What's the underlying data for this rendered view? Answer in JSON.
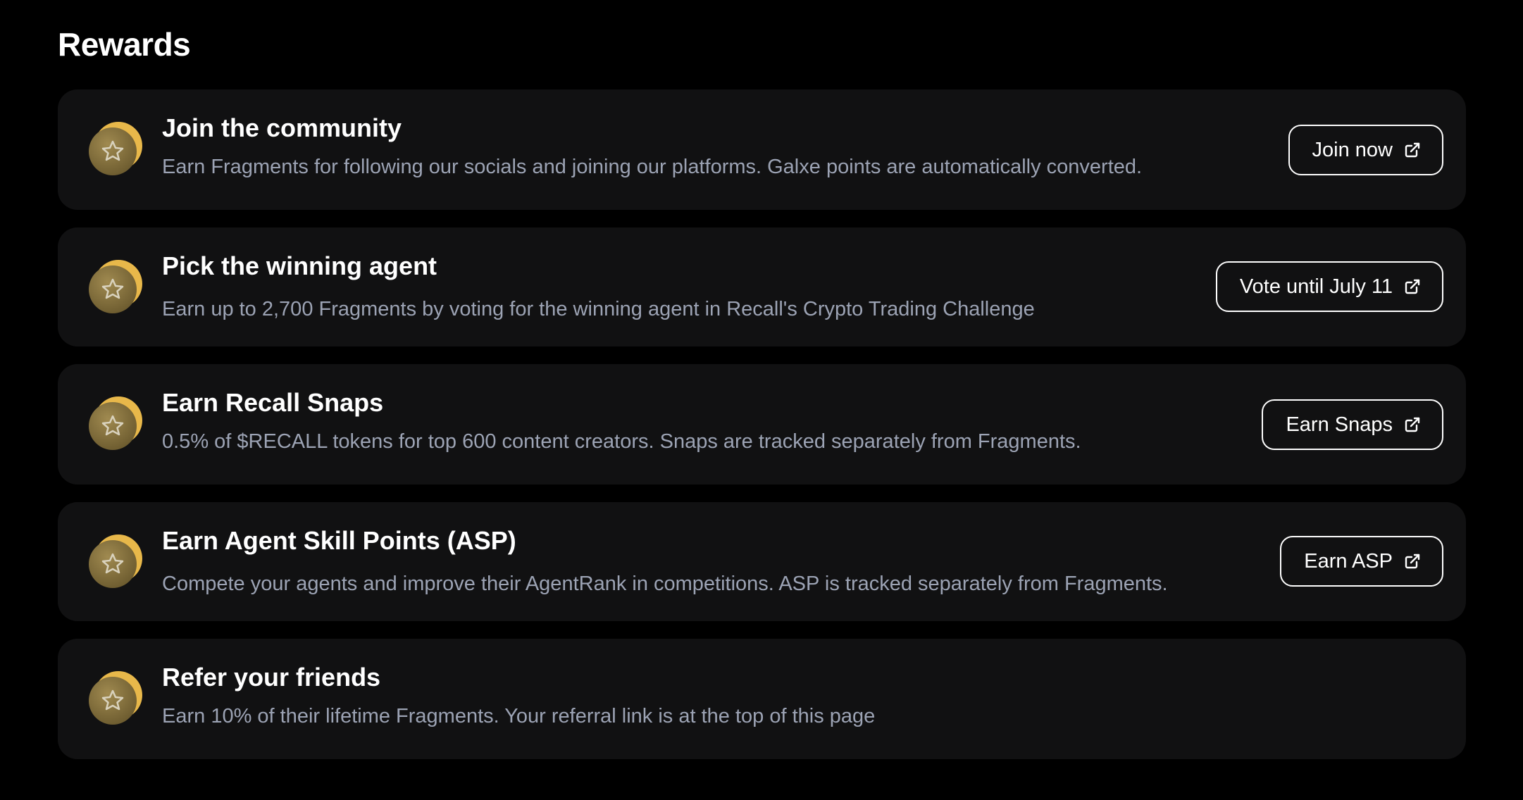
{
  "page": {
    "title": "Rewards"
  },
  "colors": {
    "background": "#000000",
    "card": "#111112",
    "description": "#9ca3b4",
    "coin_gold": "#e8b84a",
    "coin_front": "#8a7440"
  },
  "rewards": [
    {
      "icon": "star-coin-icon",
      "title": "Join the community",
      "description": "Earn Fragments for following our socials and joining our platforms. Galxe points are automatically converted.",
      "button": "Join now",
      "button_icon": "external-link-icon"
    },
    {
      "icon": "star-coin-icon",
      "title": "Pick the winning agent",
      "description": "Earn up to 2,700 Fragments by voting for the winning agent in Recall's Crypto Trading Challenge",
      "button": "Vote until July 11",
      "button_icon": "external-link-icon"
    },
    {
      "icon": "star-coin-icon",
      "title": "Earn Recall Snaps",
      "description": "0.5% of $RECALL tokens for top 600 content creators. Snaps are tracked separately from Fragments.",
      "button": "Earn Snaps",
      "button_icon": "external-link-icon"
    },
    {
      "icon": "star-coin-icon",
      "title": "Earn Agent Skill Points (ASP)",
      "description": "Compete your agents and improve their AgentRank in competitions. ASP is tracked separately from Fragments.",
      "button": "Earn ASP",
      "button_icon": "external-link-icon"
    },
    {
      "icon": "star-coin-icon",
      "title": "Refer your friends",
      "description": "Earn 10% of their lifetime Fragments. Your referral link is at the top of this page"
    }
  ]
}
